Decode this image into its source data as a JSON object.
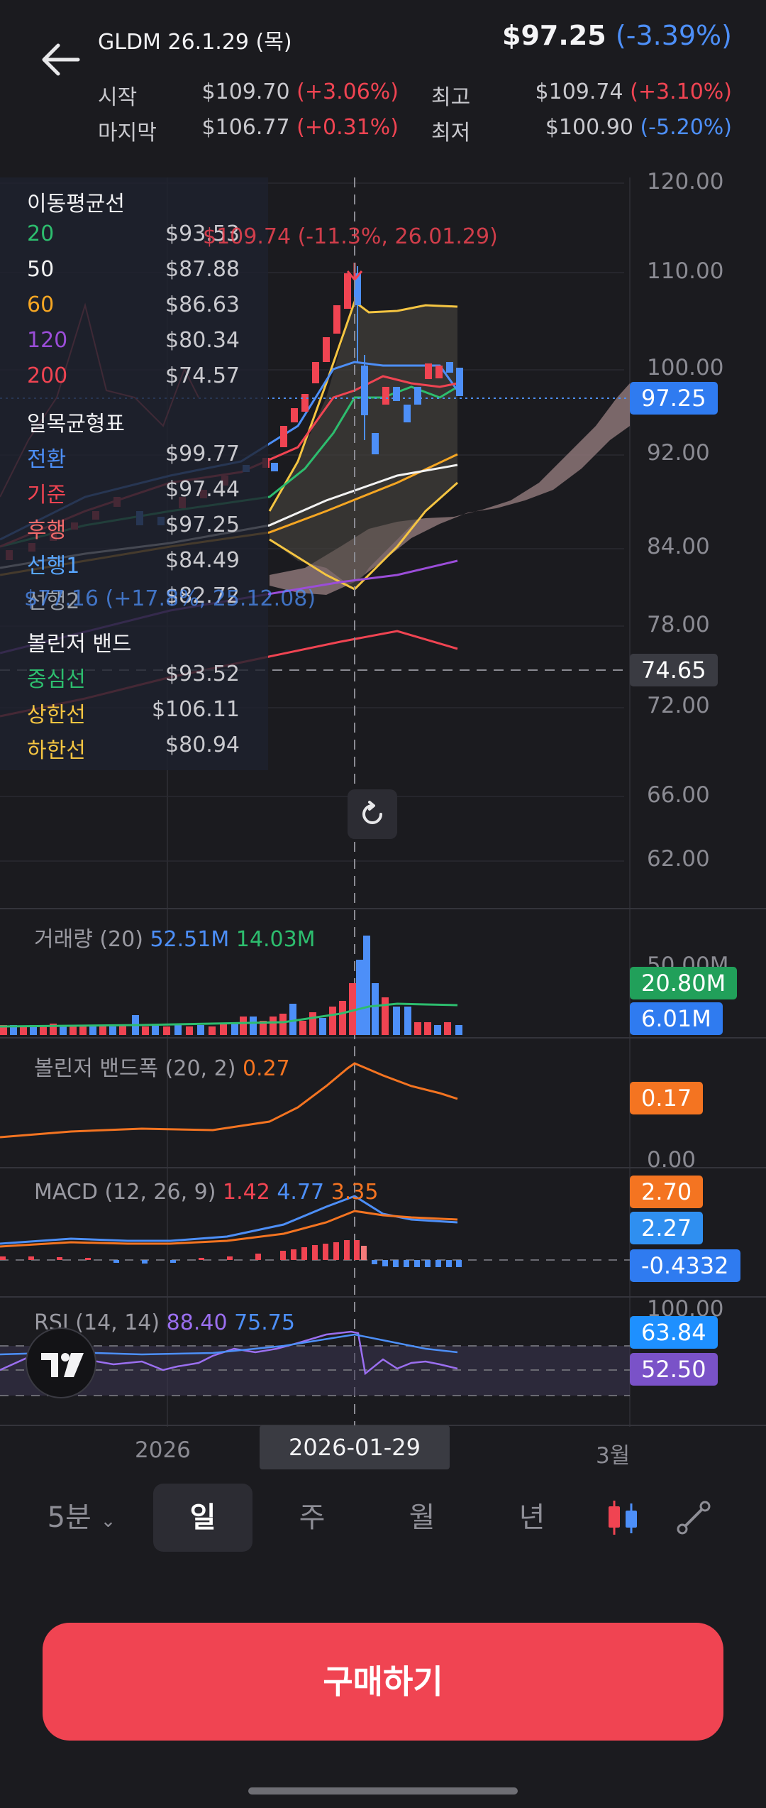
{
  "header": {
    "ticker": "GLDM 26.1.29 (목)",
    "price": "$97.25",
    "change": "(-3.39%)",
    "rows": [
      {
        "label": "시작",
        "value": "$109.70",
        "change": "(+3.06%)",
        "dir": "up"
      },
      {
        "label": "최고",
        "value": "$109.74",
        "change": "(+3.10%)",
        "dir": "up"
      },
      {
        "label": "마지막",
        "value": "$106.77",
        "change": "(+0.31%)",
        "dir": "up"
      },
      {
        "label": "최저",
        "value": "$100.90",
        "change": "(-5.20%)",
        "dir": "down"
      }
    ]
  },
  "legend": {
    "ma_title": "이동평균선",
    "ma": [
      {
        "label": "20",
        "value": "$93.53",
        "color": "#2dbd6e"
      },
      {
        "label": "50",
        "value": "$87.88",
        "color": "#f2f2f2"
      },
      {
        "label": "60",
        "value": "$86.63",
        "color": "#f5a623"
      },
      {
        "label": "120",
        "value": "$80.34",
        "color": "#9b4dd8"
      },
      {
        "label": "200",
        "value": "$74.57",
        "color": "#f04452"
      }
    ],
    "ichimoku_title": "일목균형표",
    "ichimoku": [
      {
        "label": "전환",
        "value": "$99.77",
        "color": "#4d8ff8"
      },
      {
        "label": "기준",
        "value": "$97.44",
        "color": "#f04452"
      },
      {
        "label": "후행",
        "value": "$97.25",
        "color": "#f26b6b"
      },
      {
        "label": "선행1",
        "value": "$84.49",
        "color": "#58a6ff"
      },
      {
        "label": "선행2",
        "value": "$82.72",
        "color": "#9aa0aa"
      }
    ],
    "bb_title": "볼린저 밴드",
    "bb": [
      {
        "label": "중심선",
        "value": "$93.52",
        "color": "#2dbd6e"
      },
      {
        "label": "상한선",
        "value": "$106.11",
        "color": "#f5c542"
      },
      {
        "label": "하한선",
        "value": "$80.94",
        "color": "#f5c542"
      }
    ]
  },
  "annotations": {
    "high_marker": "$109.74 (-11.3%, 26.01.29)",
    "low_marker": "$77.16 (+17.8%, 25.12.08)"
  },
  "price_axis": [
    "120.00",
    "110.00",
    "100.00",
    "92.00",
    "84.00",
    "78.00",
    "72.00",
    "66.00",
    "62.00"
  ],
  "price_tags": {
    "current": "97.25",
    "crosshair": "74.65"
  },
  "volume": {
    "label": "거래량 (20)",
    "v1": "52.51M",
    "v2": "14.03M",
    "axis": "50.00M",
    "tag_ma": "20.80M",
    "tag_vol": "6.01M"
  },
  "bbw": {
    "label": "볼린저 밴드폭 (20, 2)",
    "value": "0.27",
    "tag": "0.17",
    "axis": "0.00"
  },
  "macd": {
    "label": "MACD (12, 26, 9)",
    "v1": "1.42",
    "v2": "4.77",
    "v3": "3.35",
    "tag1": "2.70",
    "tag2": "2.27",
    "tag3": "-0.4332"
  },
  "rsi": {
    "label": "RSI (14, 14)",
    "v1": "88.40",
    "v2": "75.75",
    "axis": "100.00",
    "tag1": "63.84",
    "tag2": "52.50"
  },
  "time_axis": {
    "left": "2026",
    "crosshair": "2026-01-29",
    "right": "3월"
  },
  "tabs": [
    "5분",
    "일",
    "주",
    "월",
    "년"
  ],
  "buy_button": "구매하기",
  "colors": {
    "up": "#f04452",
    "down": "#4d8ff8",
    "background": "#1b1b1f",
    "accent_green": "#2dbd6e",
    "accent_orange": "#f47421"
  }
}
